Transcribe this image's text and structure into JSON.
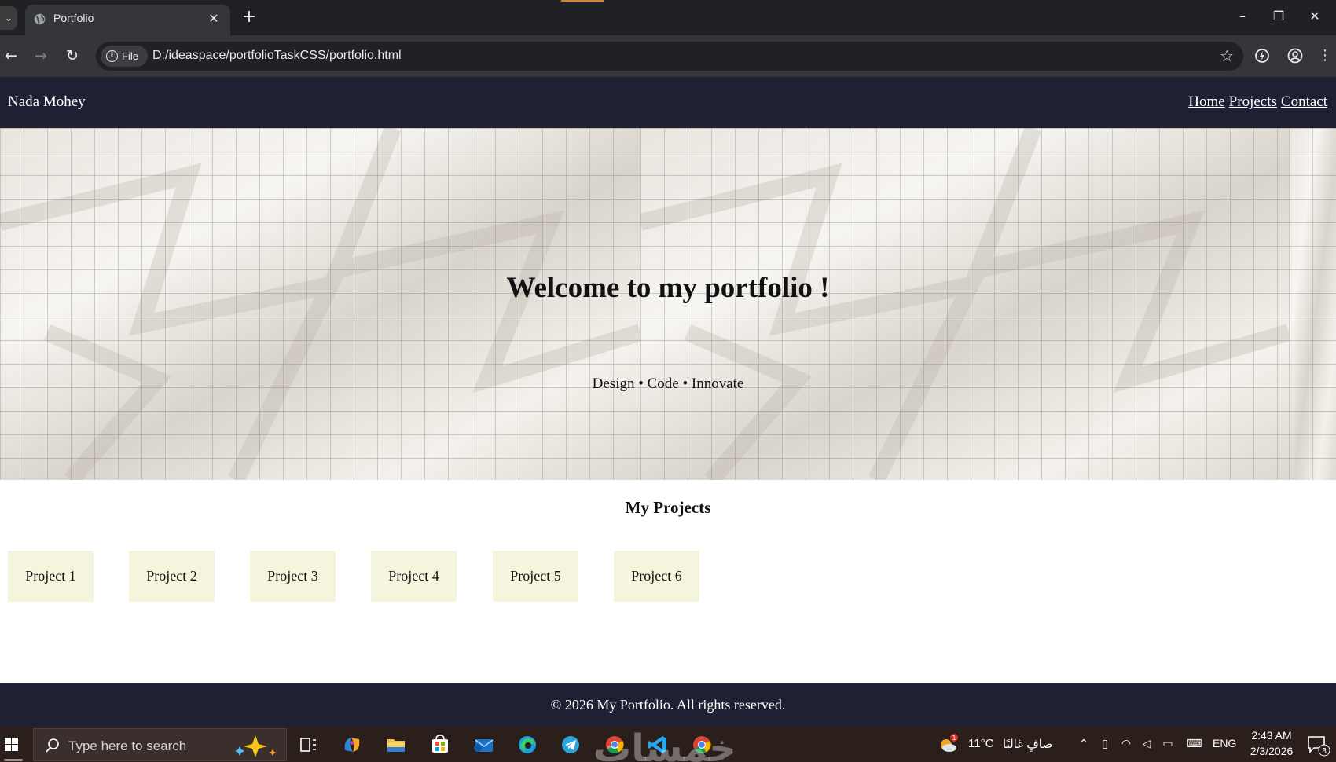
{
  "browser": {
    "tab_list_icon": "chevron-down-icon",
    "tab_title": "Portfolio",
    "tab_close": "✕",
    "new_tab": "+",
    "window_minimize": "–",
    "window_restore": "❐",
    "window_close": "✕",
    "site_info_label": "File",
    "url": "D:/ideaspace/portfolioTaskCSS/portfolio.html",
    "icons": [
      "back-icon",
      "forward-icon",
      "reload-icon",
      "info-icon",
      "bookmark-star-icon",
      "performance-icon",
      "profile-icon",
      "menu-icon"
    ]
  },
  "site": {
    "logo": "Nada Mohey",
    "nav": [
      {
        "label": "Home"
      },
      {
        "label": "Projects"
      },
      {
        "label": "Contact"
      }
    ],
    "hero": {
      "title": "Welcome to my portfolio !",
      "subtitle": "Design • Code • Innovate"
    },
    "projects_heading": "My Projects",
    "projects": [
      {
        "label": "Project 1"
      },
      {
        "label": "Project 2"
      },
      {
        "label": "Project 3"
      },
      {
        "label": "Project 4"
      },
      {
        "label": "Project 5"
      },
      {
        "label": "Project 6"
      }
    ],
    "footer": "© 2026 My Portfolio. All rights reserved.",
    "colors": {
      "header_bg": "#1f2033",
      "card_bg": "#f5f4dc"
    }
  },
  "taskbar": {
    "search_placeholder": "Type here to search",
    "weather_temp": "11°C",
    "weather_text": "صافٍ غالبًا",
    "weather_badge": "1",
    "language": "ENG",
    "time": "2:43 AM",
    "date": "2/3/2026",
    "notification_count": "3",
    "watermark": "خمسات",
    "apps": [
      "task-view-icon",
      "copilot-icon",
      "file-explorer-icon",
      "store-icon",
      "mail-icon",
      "edge-icon",
      "telegram-icon",
      "chrome-icon",
      "vscode-icon",
      "chrome-icon"
    ]
  }
}
